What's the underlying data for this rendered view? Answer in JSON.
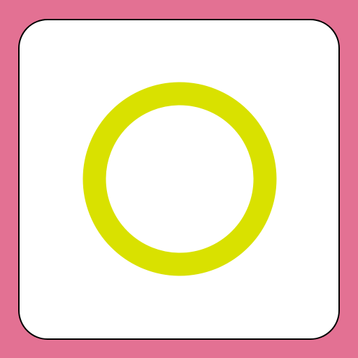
{
  "app_icon": {
    "name": "ring-app-icon",
    "colors": {
      "background": "#E37193",
      "tile": "#FFFFFF",
      "tile_border": "#000000",
      "ring": "#D9E100"
    },
    "icon": "ring-icon"
  }
}
